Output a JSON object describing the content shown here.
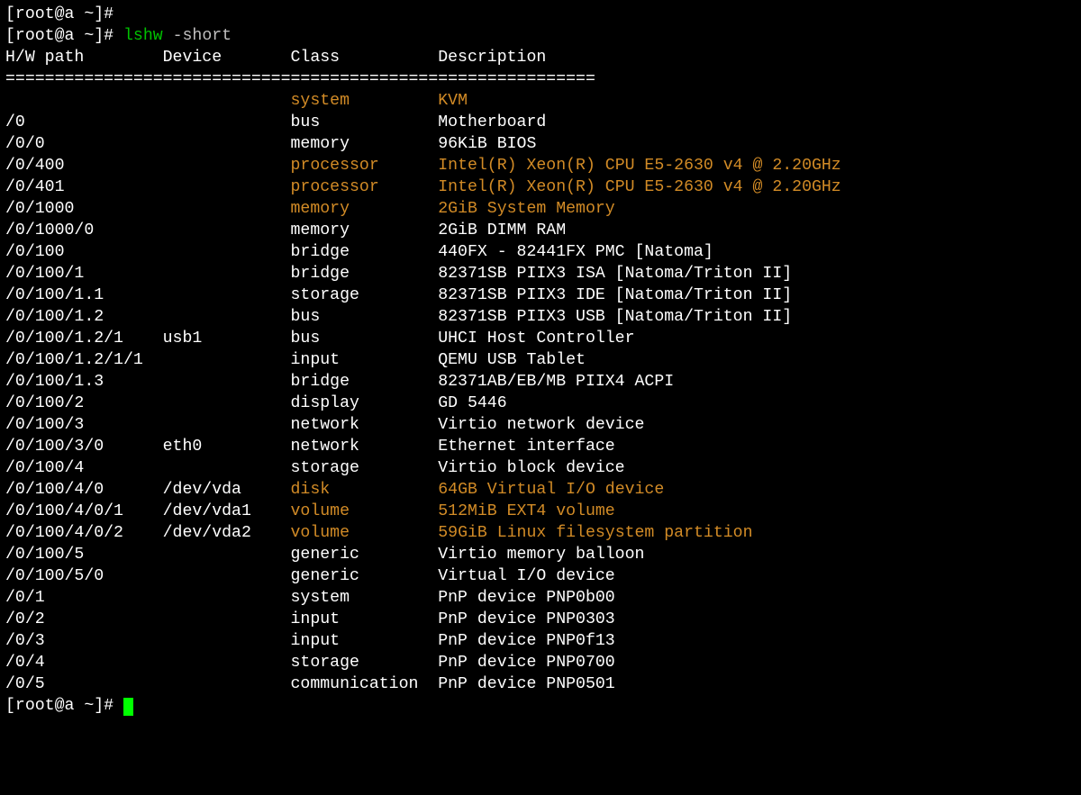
{
  "prompt": "[root@a ~]#",
  "command": {
    "exe": "lshw",
    "args": "-short"
  },
  "header": {
    "path": "H/W path",
    "device": "Device",
    "class": "Class",
    "description": "Description",
    "separator": "============================================================"
  },
  "rows": [
    {
      "path": "",
      "device": "",
      "class": "system",
      "description": "KVM",
      "hl": true
    },
    {
      "path": "/0",
      "device": "",
      "class": "bus",
      "description": "Motherboard",
      "hl": false
    },
    {
      "path": "/0/0",
      "device": "",
      "class": "memory",
      "description": "96KiB BIOS",
      "hl": false
    },
    {
      "path": "/0/400",
      "device": "",
      "class": "processor",
      "description": "Intel(R) Xeon(R) CPU E5-2630 v4 @ 2.20GHz",
      "hl": true
    },
    {
      "path": "/0/401",
      "device": "",
      "class": "processor",
      "description": "Intel(R) Xeon(R) CPU E5-2630 v4 @ 2.20GHz",
      "hl": true
    },
    {
      "path": "/0/1000",
      "device": "",
      "class": "memory",
      "description": "2GiB System Memory",
      "hl": true
    },
    {
      "path": "/0/1000/0",
      "device": "",
      "class": "memory",
      "description": "2GiB DIMM RAM",
      "hl": false
    },
    {
      "path": "/0/100",
      "device": "",
      "class": "bridge",
      "description": "440FX - 82441FX PMC [Natoma]",
      "hl": false
    },
    {
      "path": "/0/100/1",
      "device": "",
      "class": "bridge",
      "description": "82371SB PIIX3 ISA [Natoma/Triton II]",
      "hl": false
    },
    {
      "path": "/0/100/1.1",
      "device": "",
      "class": "storage",
      "description": "82371SB PIIX3 IDE [Natoma/Triton II]",
      "hl": false
    },
    {
      "path": "/0/100/1.2",
      "device": "",
      "class": "bus",
      "description": "82371SB PIIX3 USB [Natoma/Triton II]",
      "hl": false
    },
    {
      "path": "/0/100/1.2/1",
      "device": "usb1",
      "class": "bus",
      "description": "UHCI Host Controller",
      "hl": false
    },
    {
      "path": "/0/100/1.2/1/1",
      "device": "",
      "class": "input",
      "description": "QEMU USB Tablet",
      "hl": false
    },
    {
      "path": "/0/100/1.3",
      "device": "",
      "class": "bridge",
      "description": "82371AB/EB/MB PIIX4 ACPI",
      "hl": false
    },
    {
      "path": "/0/100/2",
      "device": "",
      "class": "display",
      "description": "GD 5446",
      "hl": false
    },
    {
      "path": "/0/100/3",
      "device": "",
      "class": "network",
      "description": "Virtio network device",
      "hl": false
    },
    {
      "path": "/0/100/3/0",
      "device": "eth0",
      "class": "network",
      "description": "Ethernet interface",
      "hl": false
    },
    {
      "path": "/0/100/4",
      "device": "",
      "class": "storage",
      "description": "Virtio block device",
      "hl": false
    },
    {
      "path": "/0/100/4/0",
      "device": "/dev/vda",
      "class": "disk",
      "description": "64GB Virtual I/O device",
      "hl": true
    },
    {
      "path": "/0/100/4/0/1",
      "device": "/dev/vda1",
      "class": "volume",
      "description": "512MiB EXT4 volume",
      "hl": true
    },
    {
      "path": "/0/100/4/0/2",
      "device": "/dev/vda2",
      "class": "volume",
      "description": "59GiB Linux filesystem partition",
      "hl": true
    },
    {
      "path": "/0/100/5",
      "device": "",
      "class": "generic",
      "description": "Virtio memory balloon",
      "hl": false
    },
    {
      "path": "/0/100/5/0",
      "device": "",
      "class": "generic",
      "description": "Virtual I/O device",
      "hl": false
    },
    {
      "path": "/0/1",
      "device": "",
      "class": "system",
      "description": "PnP device PNP0b00",
      "hl": false
    },
    {
      "path": "/0/2",
      "device": "",
      "class": "input",
      "description": "PnP device PNP0303",
      "hl": false
    },
    {
      "path": "/0/3",
      "device": "",
      "class": "input",
      "description": "PnP device PNP0f13",
      "hl": false
    },
    {
      "path": "/0/4",
      "device": "",
      "class": "storage",
      "description": "PnP device PNP0700",
      "hl": false
    },
    {
      "path": "/0/5",
      "device": "",
      "class": "communication",
      "description": "PnP device PNP0501",
      "hl": false
    }
  ]
}
